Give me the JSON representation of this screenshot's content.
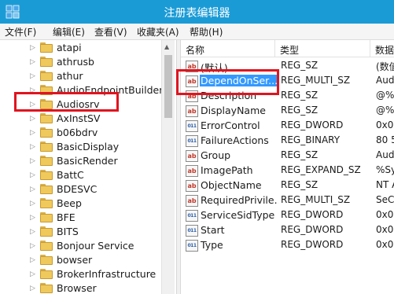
{
  "window": {
    "title": "注册表编辑器",
    "titlebar_color": "#1b9bd6",
    "icon": "regedit-icon"
  },
  "menu": {
    "items": [
      "文件(F)",
      "编辑(E)",
      "查看(V)",
      "收藏夹(A)",
      "帮助(H)"
    ]
  },
  "tree": {
    "items": [
      "atapi",
      "athrusb",
      "athur",
      "AudioEndpointBuilder",
      "Audiosrv",
      "AxInstSV",
      "b06bdrv",
      "BasicDisplay",
      "BasicRender",
      "BattC",
      "BDESVC",
      "Beep",
      "BFE",
      "BITS",
      "Bonjour Service",
      "bowser",
      "BrokerInfrastructure",
      "Browser"
    ],
    "highlighted_item": "Audiosrv"
  },
  "values": {
    "columns": [
      "名称",
      "类型",
      "数据"
    ],
    "rows": [
      {
        "name": "(默认)",
        "type": "REG_SZ",
        "data": "(数值",
        "icon": "sz"
      },
      {
        "name": "DependOnSer...",
        "type": "REG_MULTI_SZ",
        "data": "Aud",
        "icon": "sz",
        "selected": true
      },
      {
        "name": "Description",
        "type": "REG_SZ",
        "data": "@%",
        "icon": "sz"
      },
      {
        "name": "DisplayName",
        "type": "REG_SZ",
        "data": "@%",
        "icon": "sz"
      },
      {
        "name": "ErrorControl",
        "type": "REG_DWORD",
        "data": "0x0",
        "icon": "bin"
      },
      {
        "name": "FailureActions",
        "type": "REG_BINARY",
        "data": "80 5",
        "icon": "bin"
      },
      {
        "name": "Group",
        "type": "REG_SZ",
        "data": "Aud",
        "icon": "sz"
      },
      {
        "name": "ImagePath",
        "type": "REG_EXPAND_SZ",
        "data": "%Sy",
        "icon": "sz"
      },
      {
        "name": "ObjectName",
        "type": "REG_SZ",
        "data": "NT A",
        "icon": "sz"
      },
      {
        "name": "RequiredPrivile...",
        "type": "REG_MULTI_SZ",
        "data": "SeC",
        "icon": "sz"
      },
      {
        "name": "ServiceSidType",
        "type": "REG_DWORD",
        "data": "0x0",
        "icon": "bin"
      },
      {
        "name": "Start",
        "type": "REG_DWORD",
        "data": "0x0",
        "icon": "bin"
      },
      {
        "name": "Type",
        "type": "REG_DWORD",
        "data": "0x0",
        "icon": "bin"
      }
    ]
  },
  "colors": {
    "selection": "#3399ff",
    "highlight_box": "#e0141e"
  }
}
